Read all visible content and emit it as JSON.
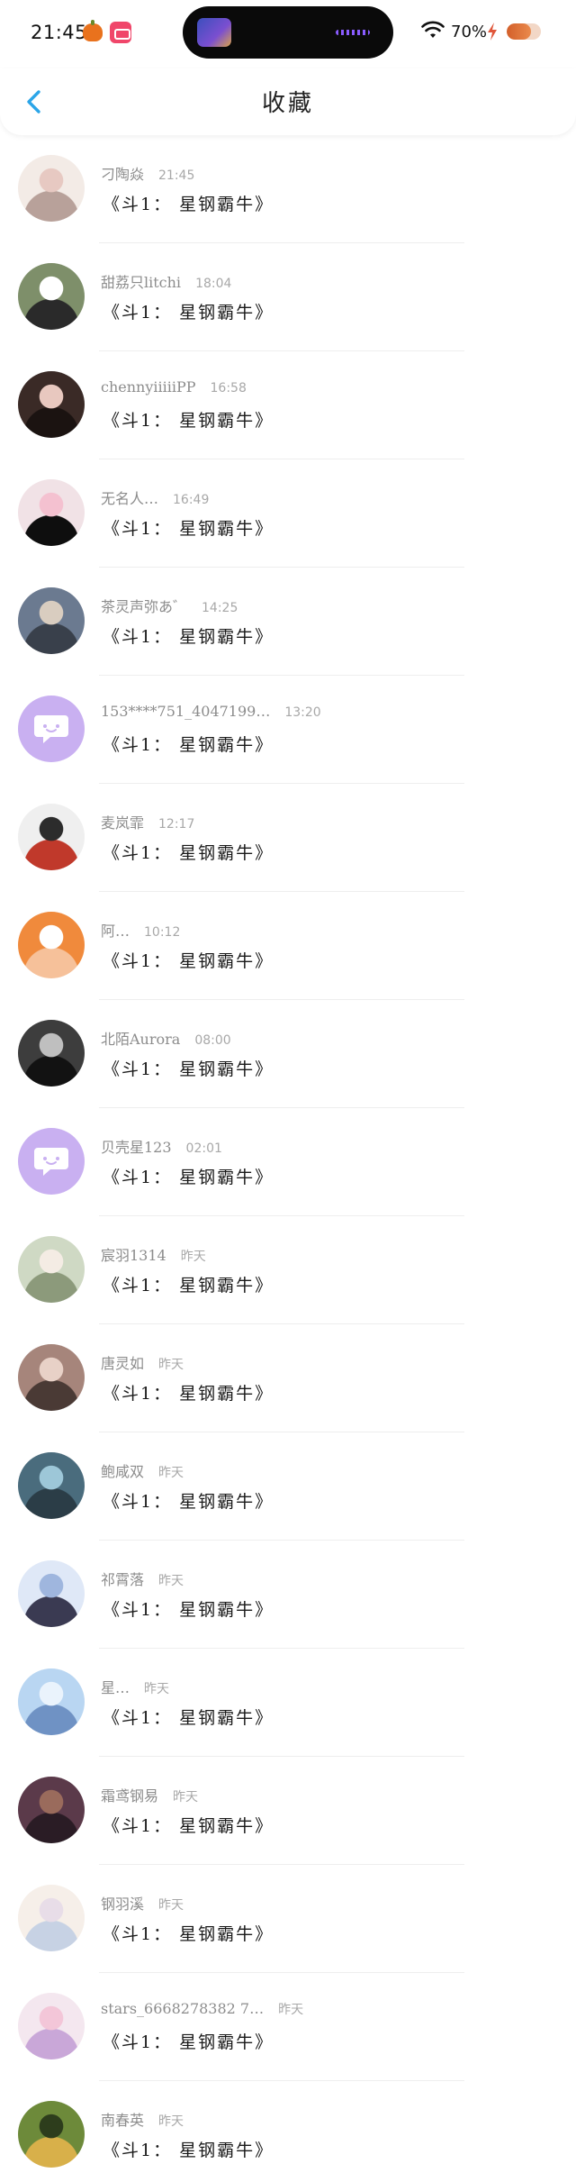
{
  "status_bar": {
    "time": "21:45",
    "battery": "70%"
  },
  "header": {
    "title": "收藏"
  },
  "colors": {
    "back_arrow": "#2ba5e8",
    "default_avatar": "#c9b0f1",
    "divider": "#eeeeee",
    "battery_fill": "#d35f2a"
  },
  "items": [
    {
      "name": "刁陶焱",
      "time": "21:45",
      "message": "《斗1： 星钢霸牛》",
      "avatar": {
        "type": "photo",
        "colors": [
          "#f3ebe6",
          "#e7c9c2",
          "#b8a19a"
        ]
      }
    },
    {
      "name": "甜荔只litchi",
      "time": "18:04",
      "message": "《斗1： 星钢霸牛》",
      "avatar": {
        "type": "photo",
        "colors": [
          "#7e8f6a",
          "#ffffff",
          "#2a2a2a"
        ]
      }
    },
    {
      "name": "chennyiiiiiPP",
      "time": "16:58",
      "message": "《斗1： 星钢霸牛》",
      "avatar": {
        "type": "photo",
        "colors": [
          "#3a2a26",
          "#e8c8bf",
          "#1b1311"
        ]
      }
    },
    {
      "name": "无名人…",
      "time": "16:49",
      "message": "《斗1： 星钢霸牛》",
      "avatar": {
        "type": "photo",
        "colors": [
          "#f1e2e6",
          "#f4c1d0",
          "#0e0e0e"
        ]
      }
    },
    {
      "name": "茶灵声弥あ゛",
      "time": "14:25",
      "message": "《斗1： 星钢霸牛》",
      "avatar": {
        "type": "photo",
        "colors": [
          "#6b7a90",
          "#d9cdc0",
          "#39404b"
        ]
      }
    },
    {
      "name": "153****751_4047199…",
      "time": "13:20",
      "message": "《斗1： 星钢霸牛》",
      "avatar": {
        "type": "default",
        "colors": [
          "#c9b0f1"
        ]
      }
    },
    {
      "name": "麦岚霏",
      "time": "12:17",
      "message": "《斗1： 星钢霸牛》",
      "avatar": {
        "type": "photo",
        "colors": [
          "#efefef",
          "#2c2c2c",
          "#c0392b"
        ]
      }
    },
    {
      "name": "阿…",
      "time": "10:12",
      "message": "《斗1： 星钢霸牛》",
      "avatar": {
        "type": "photo",
        "colors": [
          "#f08a3c",
          "#ffffff",
          "#f6c19a"
        ]
      }
    },
    {
      "name": "北陌Aurora",
      "time": "08:00",
      "message": "《斗1： 星钢霸牛》",
      "avatar": {
        "type": "photo",
        "colors": [
          "#3d3d3d",
          "#bfbfbf",
          "#121212"
        ]
      }
    },
    {
      "name": "贝壳星123",
      "time": "02:01",
      "message": "《斗1： 星钢霸牛》",
      "avatar": {
        "type": "default",
        "colors": [
          "#c9b0f1"
        ]
      }
    },
    {
      "name": "宸羽1314",
      "time": "昨天",
      "message": "《斗1： 星钢霸牛》",
      "avatar": {
        "type": "photo",
        "colors": [
          "#cfd9c4",
          "#f4ece4",
          "#8c9a7b"
        ]
      }
    },
    {
      "name": "唐灵如",
      "time": "昨天",
      "message": "《斗1： 星钢霸牛》",
      "avatar": {
        "type": "photo",
        "colors": [
          "#a6857b",
          "#e8d1c7",
          "#4a3a35"
        ]
      }
    },
    {
      "name": "鲍咸双",
      "time": "昨天",
      "message": "《斗1： 星钢霸牛》",
      "avatar": {
        "type": "photo",
        "colors": [
          "#4a6c7d",
          "#9dc7d8",
          "#2b3d47"
        ]
      }
    },
    {
      "name": "祁霄落",
      "time": "昨天",
      "message": "《斗1： 星钢霸牛》",
      "avatar": {
        "type": "photo",
        "colors": [
          "#dfe8f7",
          "#9fb6de",
          "#3a3a52"
        ]
      }
    },
    {
      "name": "星…",
      "time": "昨天",
      "message": "《斗1： 星钢霸牛》",
      "avatar": {
        "type": "photo",
        "colors": [
          "#b9d6f2",
          "#eaf3fc",
          "#6f92c4"
        ]
      }
    },
    {
      "name": "霜鸢钢易",
      "time": "昨天",
      "message": "《斗1： 星钢霸牛》",
      "avatar": {
        "type": "photo",
        "colors": [
          "#5b3a4a",
          "#9a6b5c",
          "#2a1c25"
        ]
      }
    },
    {
      "name": "钢羽溪",
      "time": "昨天",
      "message": "《斗1： 星钢霸牛》",
      "avatar": {
        "type": "photo",
        "colors": [
          "#f6efe9",
          "#e8dde8",
          "#c7d2e4"
        ]
      }
    },
    {
      "name": "stars_6668278382 7…",
      "time": "昨天",
      "message": "《斗1： 星钢霸牛》",
      "avatar": {
        "type": "photo",
        "colors": [
          "#f4e7ef",
          "#f3c6d8",
          "#c9a7d8"
        ]
      }
    },
    {
      "name": "南春英",
      "time": "昨天",
      "message": "《斗1： 星钢霸牛》",
      "avatar": {
        "type": "photo",
        "colors": [
          "#6d8a3a",
          "#2d3d1c",
          "#d8b04a"
        ]
      }
    }
  ]
}
